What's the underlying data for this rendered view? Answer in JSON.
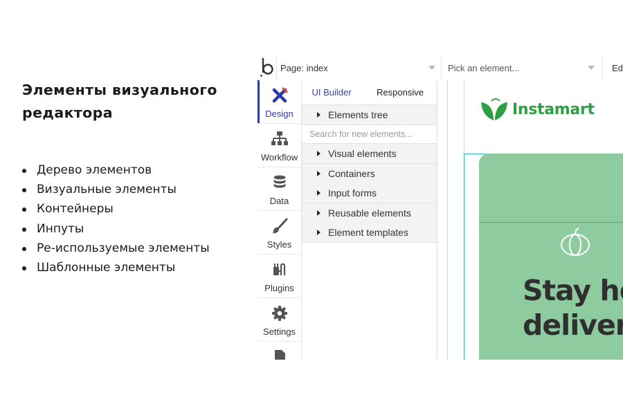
{
  "slide": {
    "title": "Элементы визуального редактора",
    "bullets": [
      "Дерево элементов",
      "Визуальные элементы",
      "Контейнеры",
      "Инпуты",
      "Ре-используемые элементы",
      "Шаблонные элементы"
    ]
  },
  "editor": {
    "topbar": {
      "logo_icon": "bubble-logo-icon",
      "page_selector": "Page: index",
      "element_picker_placeholder": "Pick an element...",
      "edit_label": "Ed"
    },
    "side_tabs": [
      {
        "label": "Design",
        "icon": "design-tools-icon",
        "active": true
      },
      {
        "label": "Workflow",
        "icon": "workflow-hierarchy-icon"
      },
      {
        "label": "Data",
        "icon": "database-icon"
      },
      {
        "label": "Styles",
        "icon": "paintbrush-icon"
      },
      {
        "label": "Plugins",
        "icon": "plug-icon"
      },
      {
        "label": "Settings",
        "icon": "gear-icon"
      }
    ],
    "panel": {
      "tabs": [
        "UI Builder",
        "Responsive"
      ],
      "active_tab": "UI Builder",
      "elements_tree": "Elements tree",
      "search_placeholder": "Search for new elements...",
      "sections": [
        "Visual elements",
        "Containers",
        "Input forms",
        "Reusable elements",
        "Element templates"
      ]
    },
    "canvas": {
      "brand_name": "Instamart",
      "brand_icon": "leaf-logo-icon",
      "hero_icon": "pumpkin-icon",
      "hero_heading_lines": [
        "Stay ho",
        "deliver"
      ],
      "colors": {
        "brand_green": "#2e9f44",
        "hero_bg": "#8ecb9e",
        "guide": "#2cb3c0",
        "accent_blue": "#2b3da3"
      }
    }
  }
}
